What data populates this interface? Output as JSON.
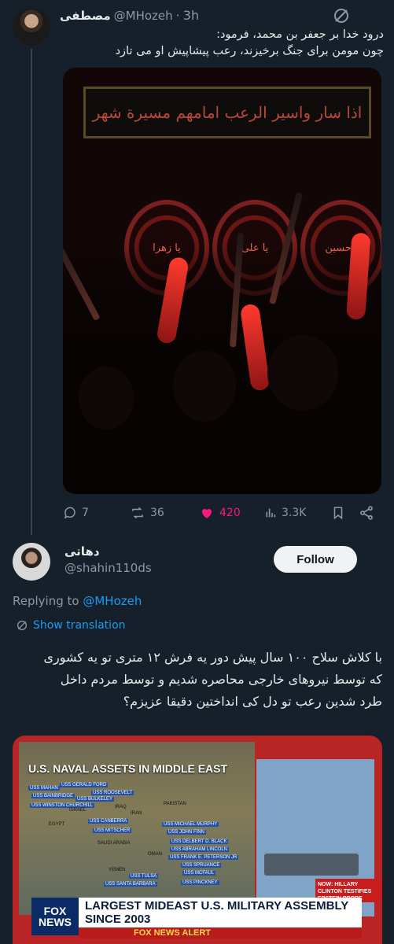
{
  "tweet": {
    "display_name": "مصطفی",
    "handle": "@MHozeh",
    "separator": "·",
    "time": "3h",
    "text_line1": "درود خدا بر جعفر بن محمد، فرمود:",
    "text_line2": "چون مومن برای جنگ برخیزند، رعب پیشاپیش او می تازد",
    "image": {
      "banner_text": "اذا سار واسیر الرعب امامهم مسیرة شهر",
      "medallions": [
        "یا زهرا",
        "یا علی",
        "یا حسین"
      ]
    },
    "actions": {
      "replies": "7",
      "reposts": "36",
      "likes": "420",
      "views": "3.3K"
    }
  },
  "reply": {
    "display_name": "دهاتی",
    "handle": "@shahin110ds",
    "follow_label": "Follow",
    "replying_to_prefix": "Replying to",
    "replying_to_handle": "@MHozeh",
    "show_translation": "Show translation",
    "text_line1": "با کلاش سلاح ۱۰۰ سال پیش دور یه فرش ۱۲ متری تو یه کشوری",
    "text_line2": "که توسط نیروهای خارجی محاصره شدیم و توسط مردم داخل",
    "text_line3": "طرد شدین رعب تو دل کی انداختین دقیقا عزیزم؟",
    "image": {
      "map_title": "U.S. NAVAL ASSETS IN MIDDLE EAST",
      "ships": [
        "USS GERALD FORD",
        "USS ROOSEVELT",
        "USS MAHAN",
        "USS BULKELEY",
        "USS BAINBRIDGE",
        "USS WINSTON CHURCHILL",
        "USS CANBERRA",
        "USS MICHAEL MURPHY",
        "USS MITSCHER",
        "USS JOHN FINN",
        "USS DELBERT D. BLACK",
        "USS ABRAHAM LINCOLN",
        "USS FRANK E. PETERSON JR",
        "USS SPRUANCE",
        "USS TULSA",
        "USS MCFAUL",
        "USS SANTA BARBARA",
        "USS PINCKNEY"
      ],
      "countries": [
        "PAKISTAN",
        "IRAN",
        "OMAN",
        "YEMEN",
        "EGYPT",
        "SAUDI ARABIA",
        "IRAQ",
        "ISRAEL"
      ],
      "lower_third": "LARGEST MIDEAST U.S. MILITARY ASSEMBLY SINCE 2003",
      "logo_line1": "FOX",
      "logo_line2": "NEWS",
      "alert": "FOX NEWS ALERT",
      "news_tag": "NOW: HILLARY CLINTON TESTIFIES EPSTEIN PROBE"
    }
  },
  "colors": {
    "background": "#15202b",
    "text": "#e7e9ea",
    "muted": "#8b98a5",
    "accent": "#1d9bf0",
    "like": "#f91880"
  }
}
